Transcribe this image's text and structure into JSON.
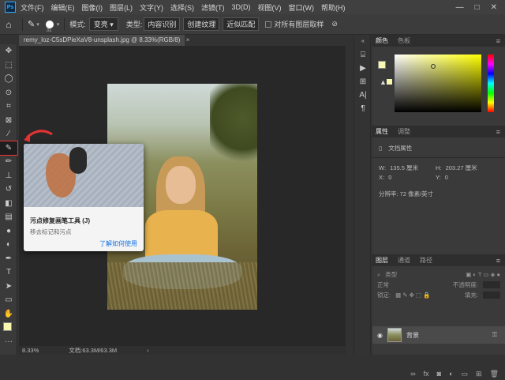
{
  "app": {
    "logo": "Ps"
  },
  "menu": [
    "文件(F)",
    "编辑(E)",
    "图像(I)",
    "图层(L)",
    "文字(Y)",
    "选择(S)",
    "滤镜(T)",
    "3D(D)",
    "视图(V)",
    "窗口(W)",
    "帮助(H)"
  ],
  "window_controls": [
    "—",
    "□",
    "✕"
  ],
  "options": {
    "home_icon": "home-icon",
    "brush_size": "31",
    "mode_label": "模式:",
    "mode_value": "变亮",
    "type_label": "类型:",
    "type_buttons": [
      "内容识别",
      "创建纹理",
      "近似匹配"
    ],
    "sample_all_layers": "对所有图层取样"
  },
  "document": {
    "tab_title": "remy_loz-C5sDPieXaV8-unsplash.jpg @ 8.33%(RGB/8)",
    "close": "×",
    "zoom": "8.33%",
    "doc_size": "文档:63.3M/63.3M"
  },
  "tooltip": {
    "title": "污点修复画笔工具 (J)",
    "description": "移去标记和污点",
    "link": "了解如何使用"
  },
  "color_panel": {
    "tabs": [
      "颜色",
      "色板"
    ],
    "fg_color": "#f8f8b0",
    "hue": "#ffff00"
  },
  "properties": {
    "tabs": [
      "属性",
      "调整"
    ],
    "heading": "文档属性",
    "w_label": "W:",
    "w_value": "135.5 厘米",
    "h_label": "H:",
    "h_value": "203.27 厘米",
    "x_label": "X:",
    "x_value": "0",
    "y_label": "Y:",
    "y_value": "0",
    "resolution": "分辨率: 72 像素/英寸"
  },
  "layers": {
    "tabs": [
      "图层",
      "通道",
      "路径"
    ],
    "filter_label": "类型",
    "blend_mode": "正常",
    "opacity_label": "不透明度:",
    "lock_label": "锁定:",
    "fill_label": "填充:",
    "layer_name": "背景"
  },
  "colors": {
    "accent": "#1473e6",
    "highlight": "#e33333"
  }
}
